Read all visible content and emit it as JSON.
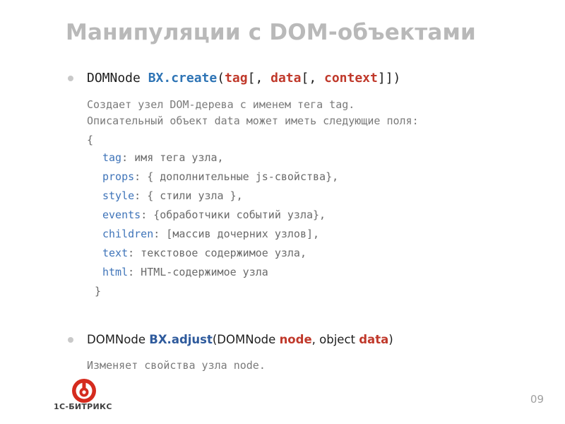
{
  "title": "Манипуляции с DOM-объектами",
  "method1": {
    "return_type": "DOMNode",
    "name": "BX.create",
    "open": "(",
    "p1": "tag",
    "sep1": "[, ",
    "p2": "data",
    "sep2": "[, ",
    "p3": "context",
    "close": "]])",
    "desc_line1": "Создает узел DOM-дерева с именем тега tag.",
    "desc_line2": "Описательный объект data может иметь следующие поля:",
    "brace_open": "{",
    "brace_close": "}",
    "fields": [
      {
        "key": "tag",
        "text": ": имя тега узла,"
      },
      {
        "key": "props",
        "text": ": { дополнительные js-свойства},"
      },
      {
        "key": "style",
        "text": ": { стили узла },"
      },
      {
        "key": "events",
        "text": ": {обработчики событий узла},"
      },
      {
        "key": "children",
        "text": ": [массив дочерних узлов],"
      },
      {
        "key": "text",
        "text": ": текстовое содержимое узла,"
      },
      {
        "key": "html",
        "text": ": HTML-содержимое узла"
      }
    ]
  },
  "method2": {
    "return_type": "DOMNode",
    "name": "BX.adjust",
    "open": "(DOMNode ",
    "p1": "node",
    "sep1": ", object ",
    "p2": "data",
    "close": ")",
    "desc": "Изменяет свойства узла node."
  },
  "logo": {
    "text": "1С-БИТРИКС",
    "icon": "bitrix-logo-icon",
    "color": "#d52b1e"
  },
  "page_number": "09",
  "colors": {
    "title": "#b9b9b9",
    "method": "#2e74b5",
    "param": "#c0392b",
    "field_key": "#3f74b9",
    "text": "#6a6a6a"
  }
}
